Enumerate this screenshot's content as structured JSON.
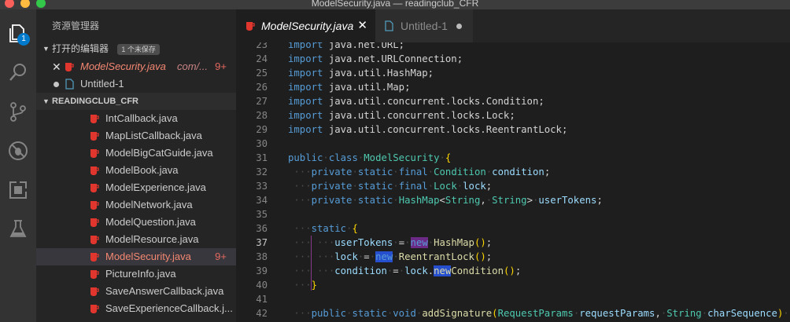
{
  "window": {
    "title": "ModelSecurity.java — readingclub_CFR"
  },
  "activity_bar": {
    "explorer_badge": "1",
    "icons": [
      "files-icon",
      "search-icon",
      "source-control-icon",
      "debug-icon",
      "extensions-icon",
      "flask-icon"
    ]
  },
  "sidebar": {
    "title": "资源管理器",
    "open_editors": {
      "label": "打开的编辑器",
      "unsaved_badge": "1 个未保存",
      "items": [
        {
          "name": "ModelSecurity.java",
          "path": "com/...",
          "count": "9+"
        },
        {
          "name": "Untitled-1"
        }
      ]
    },
    "project": {
      "label": "READINGCLUB_CFR",
      "files": [
        {
          "name": "IntCallback.java"
        },
        {
          "name": "MapListCallback.java"
        },
        {
          "name": "ModelBigCatGuide.java"
        },
        {
          "name": "ModelBook.java"
        },
        {
          "name": "ModelExperience.java"
        },
        {
          "name": "ModelNetwork.java"
        },
        {
          "name": "ModelQuestion.java"
        },
        {
          "name": "ModelResource.java"
        },
        {
          "name": "ModelSecurity.java",
          "count": "9+"
        },
        {
          "name": "PictureInfo.java"
        },
        {
          "name": "SaveAnswerCallback.java"
        },
        {
          "name": "SaveExperienceCallback.j..."
        }
      ]
    }
  },
  "tabs": [
    {
      "label": "ModelSecurity.java",
      "close": "✕"
    },
    {
      "label": "Untitled-1"
    }
  ],
  "editor": {
    "current_line": "37",
    "lines": [
      {
        "n": "23",
        "t": "import java.net.URL;"
      },
      {
        "n": "24",
        "t": "import java.net.URLConnection;"
      },
      {
        "n": "25",
        "t": "import java.util.HashMap;"
      },
      {
        "n": "26",
        "t": "import java.util.Map;"
      },
      {
        "n": "27",
        "t": "import java.util.concurrent.locks.Condition;"
      },
      {
        "n": "28",
        "t": "import java.util.concurrent.locks.Lock;"
      },
      {
        "n": "29",
        "t": "import java.util.concurrent.locks.ReentrantLock;"
      },
      {
        "n": "30",
        "t": ""
      },
      {
        "n": "31",
        "t": "public class ModelSecurity {"
      },
      {
        "n": "32",
        "t": "    private static final Condition condition;"
      },
      {
        "n": "33",
        "t": "    private static final Lock lock;"
      },
      {
        "n": "34",
        "t": "    private static HashMap<String, String> userTokens;"
      },
      {
        "n": "35",
        "t": ""
      },
      {
        "n": "36",
        "t": "    static {"
      },
      {
        "n": "37",
        "t": "        userTokens = new HashMap();"
      },
      {
        "n": "38",
        "t": "        lock = new ReentrantLock();"
      },
      {
        "n": "39",
        "t": "        condition = lock.newCondition();"
      },
      {
        "n": "40",
        "t": "    }"
      },
      {
        "n": "41",
        "t": ""
      },
      {
        "n": "42",
        "t": "    public static void addSignature(RequestParams requestParams, String charSequence) {"
      }
    ]
  },
  "colors": {
    "keyword": "#569cd6",
    "type": "#4ec9b0",
    "function": "#dcdcaa",
    "variable": "#9cdcfe",
    "error": "#f48771",
    "java_icon": "#e0362e",
    "accent": "#007acc"
  }
}
